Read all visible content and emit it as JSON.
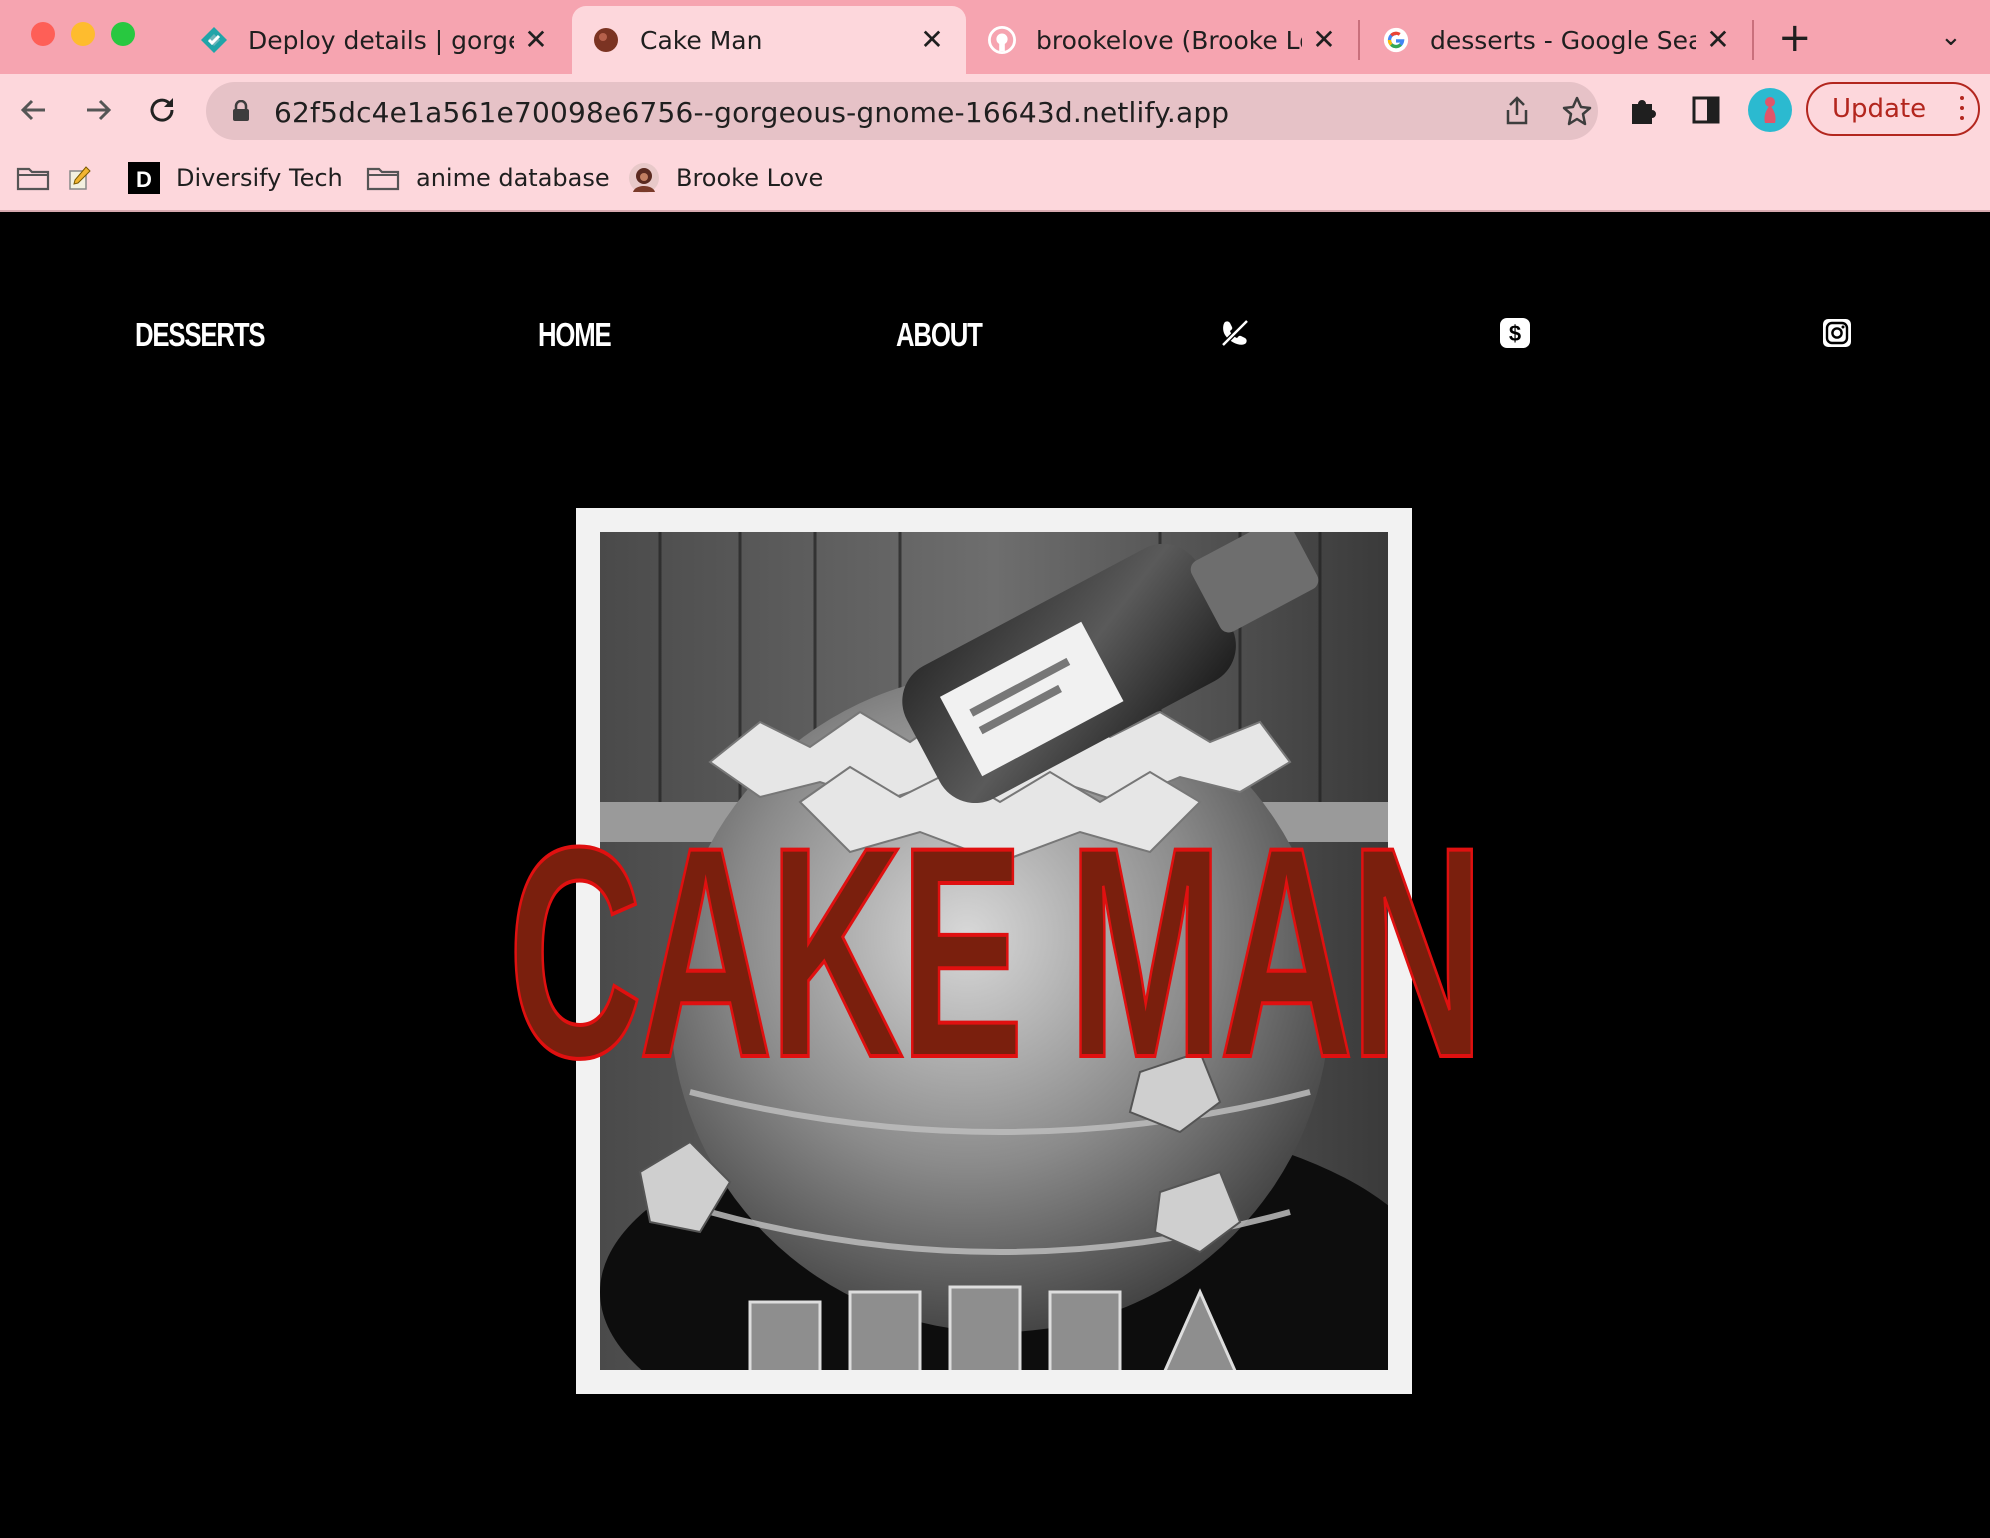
{
  "browser": {
    "tabs": [
      {
        "title": "Deploy details | gorgeou",
        "favicon": "netlify-icon",
        "active": false
      },
      {
        "title": "Cake Man",
        "favicon": "cake-favicon",
        "active": true
      },
      {
        "title": "brookelove (Brooke Lov",
        "favicon": "github-icon",
        "active": false
      },
      {
        "title": "desserts - Google Searc",
        "favicon": "google-icon",
        "active": false
      }
    ],
    "close_glyph": "✕",
    "new_tab_glyph": "+",
    "tab_menu_glyph": "⌄",
    "url": "62f5dc4e1a561e70098e6756--gorgeous-gnome-16643d.netlify.app",
    "update_label": "Update",
    "bookmarks": [
      {
        "label": "",
        "icon": "folder-icon"
      },
      {
        "label": "",
        "icon": "notepad-icon"
      },
      {
        "label": "Diversify Tech",
        "icon": "d-logo-icon"
      },
      {
        "label": "anime database",
        "icon": "folder-icon"
      },
      {
        "label": "Brooke Love",
        "icon": "avatar-icon"
      }
    ],
    "colors": {
      "tabstrip": "#f6a4b0",
      "toolbar": "#fdd7dc",
      "omnibox": "#e6c2c7",
      "update": "#b3261e"
    }
  },
  "site": {
    "nav": {
      "desserts": "DESSERTS",
      "home": "HOME",
      "about": "ABOUT"
    },
    "icons": [
      "no-phone-icon",
      "cash-app-icon",
      "instagram-icon"
    ],
    "hero_title": "CAKE MAN",
    "photo_alt": "black and white photo of a Remy Martin bottle cake",
    "colors": {
      "background": "#000000",
      "title_fill": "#7a1f0d",
      "title_stroke": "#e01010",
      "frame": "#f2f2f2"
    }
  }
}
